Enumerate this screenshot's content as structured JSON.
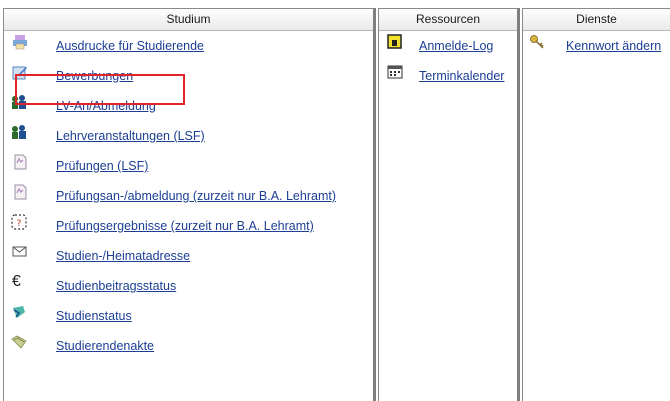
{
  "studium": {
    "title": "Studium",
    "items": [
      {
        "label": "Ausdrucke für Studierende",
        "icon": "printer-icon"
      },
      {
        "label": "Bewerbungen",
        "icon": "edit-form-icon"
      },
      {
        "label": "LV-An/Abmeldung",
        "icon": "course-registration-icon"
      },
      {
        "label": "Lehrveranstaltungen (LSF)",
        "icon": "courses-icon"
      },
      {
        "label": "Prüfungen (LSF)",
        "icon": "exam-document-icon"
      },
      {
        "label": "Prüfungsan-/abmeldung (zurzeit nur B.A. Lehramt)",
        "icon": "exam-document-icon"
      },
      {
        "label": "Prüfungsergebnisse (zurzeit nur B.A. Lehramt)",
        "icon": "results-icon"
      },
      {
        "label": "Studien-/Heimatadresse",
        "icon": "envelope-icon"
      },
      {
        "label": "Studienbeitragsstatus",
        "icon": "euro-icon"
      },
      {
        "label": "Studienstatus",
        "icon": "status-icon"
      },
      {
        "label": "Studierendenakte",
        "icon": "file-folder-icon"
      }
    ]
  },
  "ressourcen": {
    "title": "Ressourcen",
    "items": [
      {
        "label": "Anmelde-Log",
        "icon": "log-icon"
      },
      {
        "label": "Terminkalender",
        "icon": "calendar-icon"
      }
    ]
  },
  "dienste": {
    "title": "Dienste",
    "items": [
      {
        "label": "Kennwort ändern",
        "icon": "key-icon"
      }
    ]
  },
  "colors": {
    "link": "#1c3f94",
    "highlight": "#e0242c"
  }
}
